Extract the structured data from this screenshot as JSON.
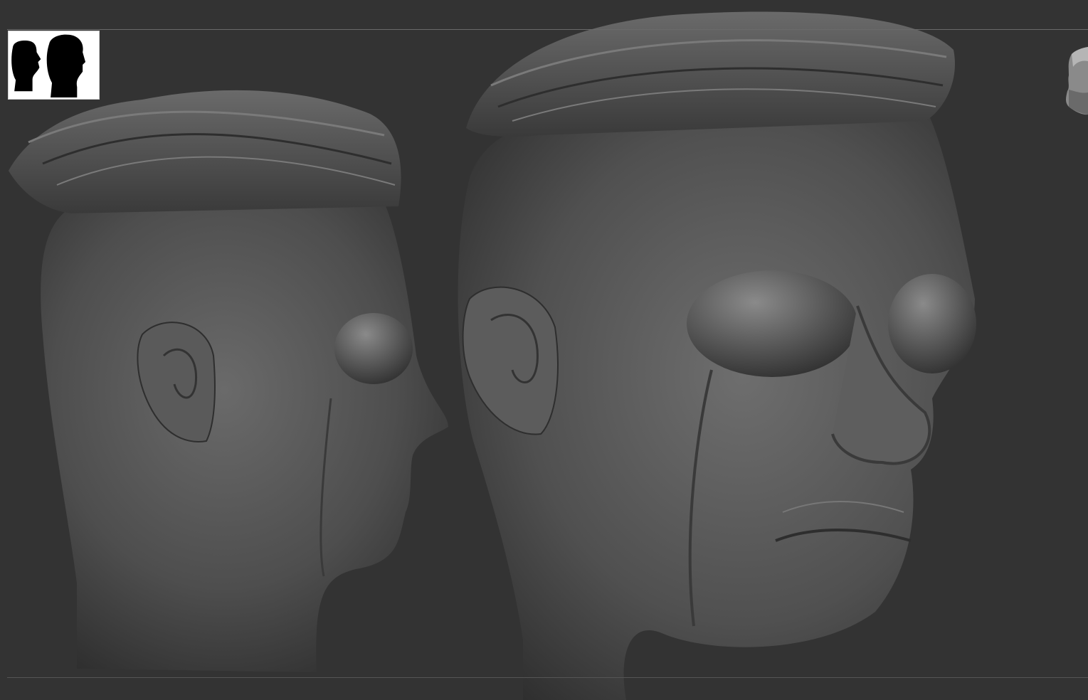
{
  "app": {
    "name": "",
    "viewport_background": "#333333"
  },
  "thumbnail": {
    "icon": "head-silhouettes-icon"
  },
  "viewport": {
    "models": [
      {
        "view": "side-profile",
        "icon": "head-sculpt-side"
      },
      {
        "view": "three-quarter",
        "icon": "head-sculpt-front"
      }
    ]
  },
  "navigation": {
    "icon": "orientation-head-icon"
  }
}
